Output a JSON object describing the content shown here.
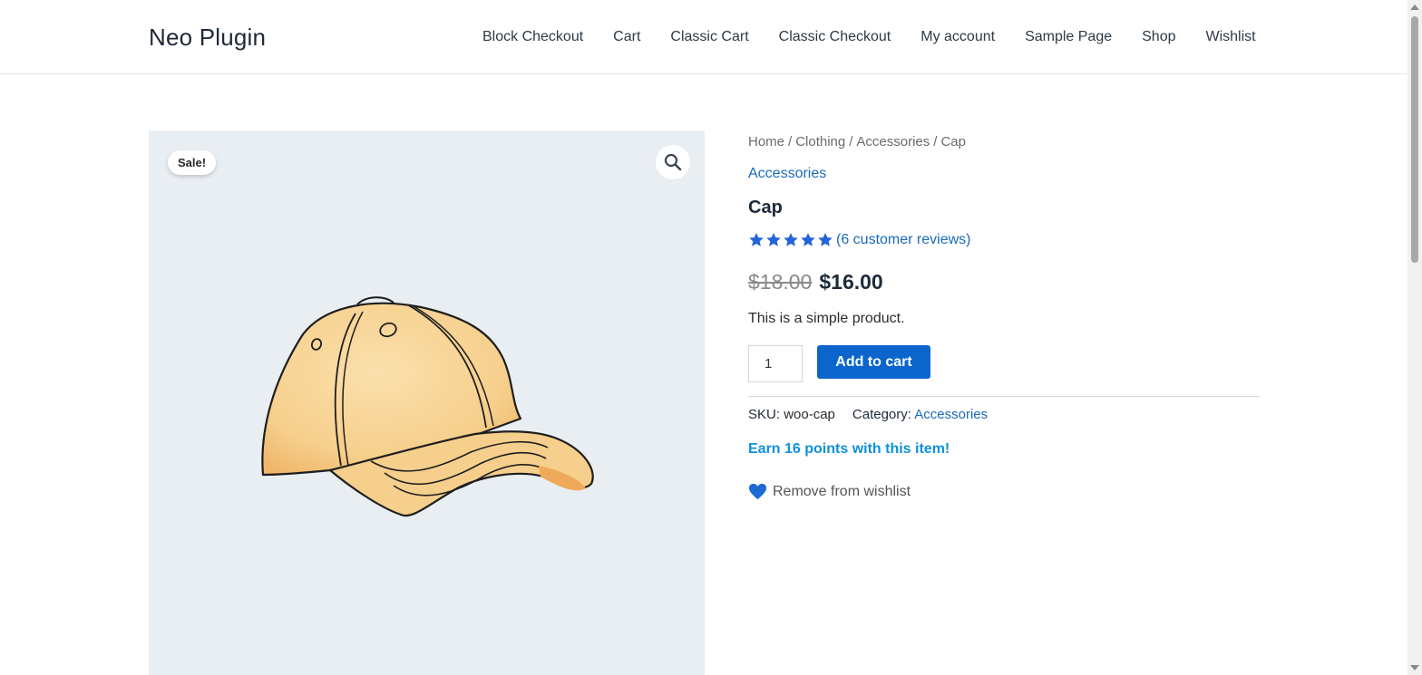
{
  "header": {
    "site_title": "Neo Plugin",
    "nav": [
      {
        "label": "Block Checkout"
      },
      {
        "label": "Cart"
      },
      {
        "label": "Classic Cart"
      },
      {
        "label": "Classic Checkout"
      },
      {
        "label": "My account"
      },
      {
        "label": "Sample Page"
      },
      {
        "label": "Shop"
      },
      {
        "label": "Wishlist"
      }
    ]
  },
  "gallery": {
    "sale_badge": "Sale!",
    "zoom_icon": "magnifier-icon",
    "image_subject": "cap-illustration"
  },
  "product": {
    "breadcrumb": [
      "Home",
      "Clothing",
      "Accessories",
      "Cap"
    ],
    "breadcrumb_separator": "/",
    "category_link": "Accessories",
    "title": "Cap",
    "rating": {
      "stars": 5,
      "max": 5,
      "reviews_label": "(6 customer reviews)"
    },
    "old_price": "$18.00",
    "price": "$16.00",
    "short_description": "This is a simple product.",
    "quantity": "1",
    "add_to_cart_label": "Add to cart",
    "sku_label": "SKU:",
    "sku_value": "woo-cap",
    "category_label": "Category:",
    "category_value": "Accessories",
    "points_message": "Earn 16 points with this item!",
    "wishlist_label": "Remove from wishlist"
  },
  "colors": {
    "link": "#1c6ab6",
    "button": "#0a66cc",
    "stars": "#2563d8",
    "points": "#0f90dd",
    "gallery_bg": "#e9eef3"
  }
}
